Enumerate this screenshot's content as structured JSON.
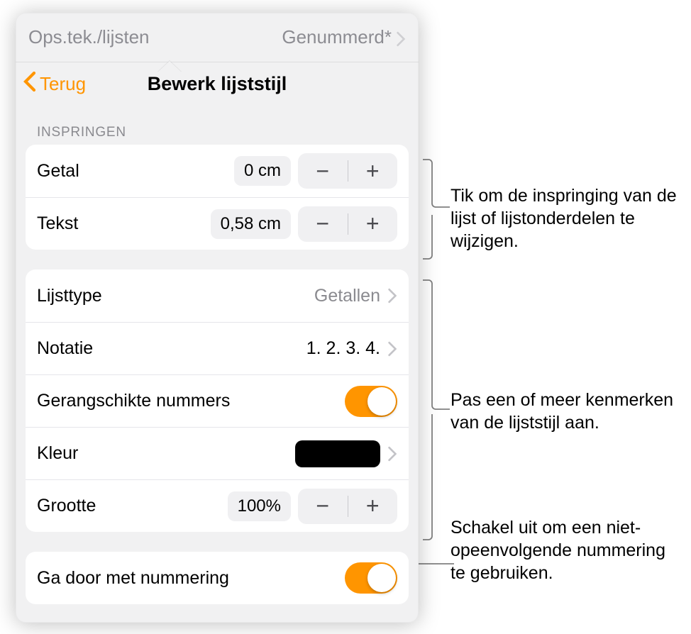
{
  "top": {
    "left_label": "Ops.tek./lijsten",
    "right_value": "Genummerd*"
  },
  "nav": {
    "back_label": "Terug",
    "title": "Bewerk lijststijl"
  },
  "sections": {
    "indent": {
      "header": "INSPRINGEN",
      "number_label": "Getal",
      "number_value": "0 cm",
      "text_label": "Tekst",
      "text_value": "0,58 cm"
    },
    "style": {
      "listtype_label": "Lijsttype",
      "listtype_value": "Getallen",
      "notation_label": "Notatie",
      "notation_value": "1. 2. 3. 4.",
      "ordered_label": "Gerangschikte nummers",
      "ordered_on": true,
      "color_label": "Kleur",
      "color_value": "#000000",
      "size_label": "Grootte",
      "size_value": "100%"
    },
    "continue": {
      "label": "Ga door met nummering",
      "on": true
    }
  },
  "callouts": {
    "c1": "Tik om de inspringing van de lijst of lijstonderdelen te wijzigen.",
    "c2": "Pas een of meer kenmerken van de lijststijl aan.",
    "c3": "Schakel uit om een niet-opeenvolgende nummering te gebruiken."
  },
  "glyph": {
    "minus": "−",
    "plus": "+"
  }
}
